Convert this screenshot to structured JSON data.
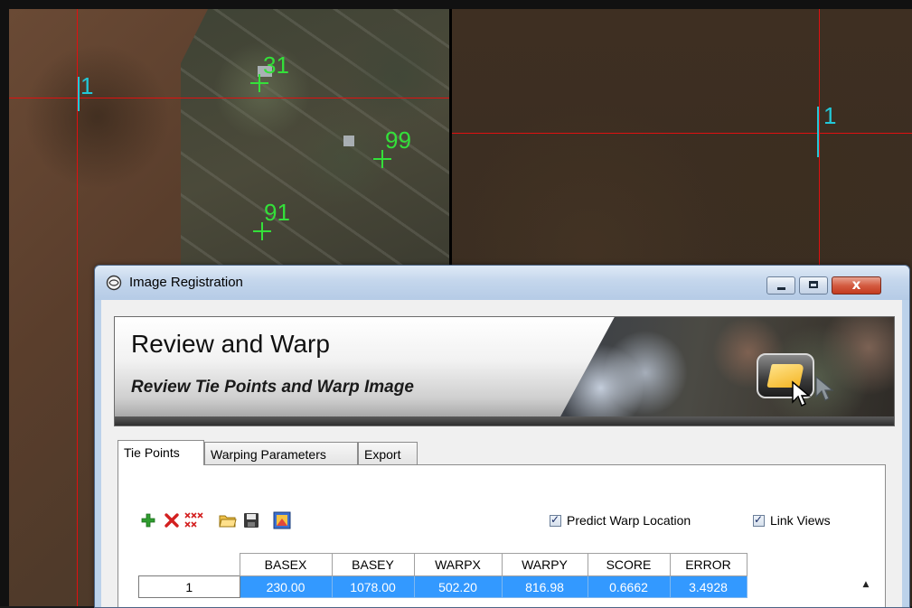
{
  "map": {
    "left_labels": [
      "31",
      "99",
      "91",
      "1"
    ],
    "right_labels": [
      "1"
    ]
  },
  "window": {
    "title": "Image Registration",
    "close_glyph": "x"
  },
  "banner": {
    "title": "Review and Warp",
    "subtitle": "Review Tie Points and Warp Image"
  },
  "tabs": [
    "Tie Points",
    "Warping Parameters",
    "Export"
  ],
  "toolbar": {
    "icons": [
      "add-icon",
      "delete-icon",
      "delete-all-icon",
      "open-icon",
      "save-icon",
      "image-icon"
    ],
    "predict_label": "Predict Warp Location",
    "link_label": "Link Views",
    "predict_checked": true,
    "link_checked": true
  },
  "table": {
    "headers": [
      "BASEX",
      "BASEY",
      "WARPX",
      "WARPY",
      "SCORE",
      "ERROR"
    ],
    "rows": [
      {
        "id": "1",
        "cells": [
          "230.00",
          "1078.00",
          "502.20",
          "816.98",
          "0.6662",
          "3.4928"
        ]
      }
    ]
  },
  "colors": {
    "accent": "#3399ff",
    "tiepoint_green": "#34e03a",
    "tiepoint_cyan": "#22c8d8",
    "crosshair_red": "#e01010"
  }
}
